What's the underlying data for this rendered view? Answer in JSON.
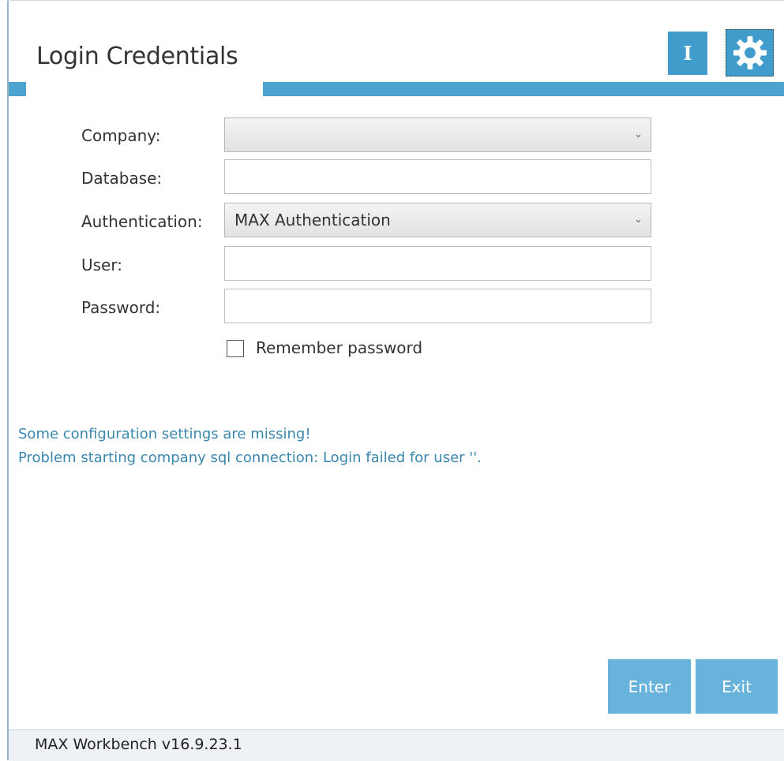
{
  "header": {
    "title": "Login Credentials",
    "info_icon": "info-icon",
    "settings_icon": "gear-icon",
    "info_glyph": "I"
  },
  "form": {
    "company": {
      "label": "Company:",
      "value": ""
    },
    "database": {
      "label": "Database:",
      "value": ""
    },
    "authentication": {
      "label": "Authentication:",
      "value": "MAX Authentication"
    },
    "user": {
      "label": "User:",
      "value": ""
    },
    "password": {
      "label": "Password:",
      "value": ""
    },
    "remember": {
      "label": "Remember password",
      "checked": false
    }
  },
  "messages": [
    "Some configuration settings are missing!",
    "Problem starting company sql connection: Login failed for user ''."
  ],
  "buttons": {
    "enter": "Enter",
    "exit": "Exit"
  },
  "footer": {
    "version": "MAX Workbench v16.9.23.1"
  },
  "colors": {
    "accent": "#4da3cf",
    "button": "#68b3dc",
    "message": "#3a87ad"
  }
}
